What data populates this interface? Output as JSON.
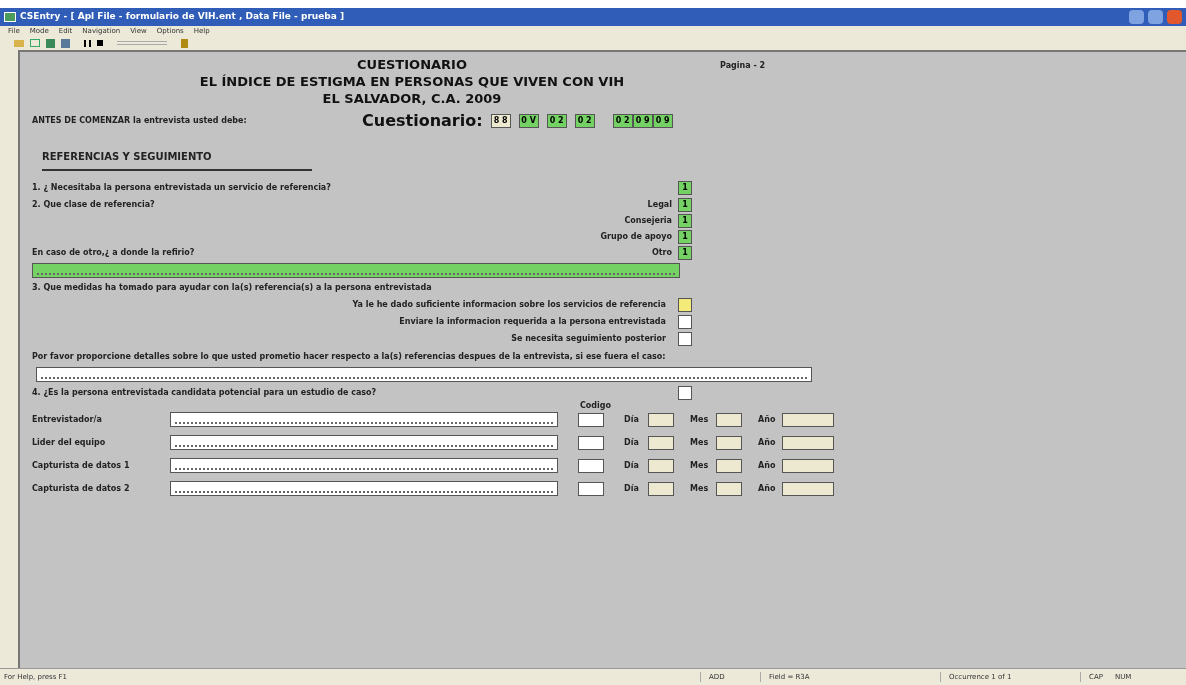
{
  "window": {
    "title": "CSEntry - [ Apl File - formulario de VIH.ent , Data File - prueba ]"
  },
  "menu": [
    "File",
    "Mode",
    "Edit",
    "Navigation",
    "View",
    "Options",
    "Help"
  ],
  "form": {
    "headings": [
      "CUESTIONARIO",
      "EL ÍNDICE DE ESTIGMA EN PERSONAS QUE VIVEN CON VIH",
      "EL SALVADOR, C.A. 2009"
    ],
    "page": "Pagina - 2",
    "intro": "ANTES DE COMENZAR la entrevista usted debe:",
    "code_label": "Cuestionario:",
    "code_groups": [
      [
        {
          "value": "8 8",
          "color": "#ece9d0"
        }
      ],
      [
        {
          "value": "0 V",
          "color": "#74d163"
        }
      ],
      [
        {
          "value": "0 2",
          "color": "#74d163"
        }
      ],
      [
        {
          "value": "0 2",
          "color": "#74d163"
        }
      ],
      [
        {
          "value": "0 2",
          "color": "#74d163"
        },
        {
          "value": "0 9",
          "color": "#74d163"
        },
        {
          "value": "0 9",
          "color": "#74d163"
        }
      ]
    ],
    "section": "REFERENCIAS Y SEGUIMIENTO",
    "q1": {
      "text": "1. ¿ Necesitaba la persona entrevistada un servicio de referencia?",
      "value": "1",
      "color": "#74d163"
    },
    "q2": {
      "text": "2. Que clase de referencia?",
      "options": [
        {
          "label": "Legal",
          "value": "1",
          "color": "#74d163"
        },
        {
          "label": "Consejeria",
          "value": "1",
          "color": "#74d163"
        },
        {
          "label": "Grupo de apoyo",
          "value": "1",
          "color": "#74d163"
        },
        {
          "label": "Otro",
          "value": "1",
          "color": "#74d163"
        }
      ],
      "other_text": "En caso de otro,¿ a donde la refirio?",
      "other_filled": true
    },
    "q3": {
      "text": "3. Que medidas ha tomado para ayudar con la(s) referencia(s) a la persona entrevistada",
      "options": [
        {
          "label": "Ya le he dado suficiente informacion sobre los servicios de referencia",
          "color": "#f3ea7a"
        },
        {
          "label": "Enviare la informacion requerida a la persona entrevistada",
          "color": "#ffffff"
        },
        {
          "label": "Se necesita seguimiento posterior",
          "color": "#ffffff"
        }
      ]
    },
    "details": {
      "text": "Por favor proporcione detalles sobre  lo que usted prometio hacer respecto a la(s)  referencias despues de la entrevista, si ese fuera el caso:"
    },
    "q4": {
      "text": "4. ¿Es la persona entrevistada candidata potencial para un estudio de caso?"
    },
    "codigo_label": "Codigo",
    "staff": [
      {
        "label": "Entrevistador/a",
        "day": "Día",
        "month": "Mes",
        "year": "Año"
      },
      {
        "label": "Lider del equipo",
        "day": "Día",
        "month": "Mes",
        "year": "Año"
      },
      {
        "label": "Capturista de datos 1",
        "day": "Día",
        "month": "Mes",
        "year": "Año"
      },
      {
        "label": "Capturista de datos 2",
        "day": "Día",
        "month": "Mes",
        "year": "Año"
      }
    ]
  },
  "status_bar": {
    "help": "For Help, press F1",
    "mode": "ADD",
    "field": "Field = R3A",
    "occurrence": "Occurrence 1 of 1",
    "caps": "CAP",
    "num": "NUM"
  }
}
